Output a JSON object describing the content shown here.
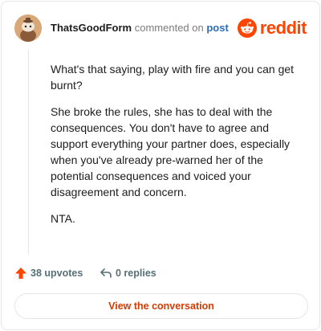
{
  "header": {
    "username": "ThatsGoodForm",
    "action_text": "commented on",
    "post_link": "post",
    "brand": "reddit"
  },
  "comment": {
    "paragraphs": [
      "What's that saying, play with fire and you can get burnt?",
      "She broke the rules, she has to deal with the consequences. You don't have to agree and support everything your partner does, especially when you've already pre-warned her of the potential consequences and voiced your disagreement and concern.",
      "NTA."
    ]
  },
  "actions": {
    "upvotes": "38 upvotes",
    "replies": "0 replies"
  },
  "cta": {
    "label": "View the conversation"
  },
  "colors": {
    "brand": "#ff4500",
    "link": "#2b6cb0",
    "cta": "#d93a00"
  },
  "icons": [
    "snoo-avatar-icon",
    "reddit-snoo-icon",
    "upvote-arrow-icon",
    "reply-arrow-icon"
  ]
}
